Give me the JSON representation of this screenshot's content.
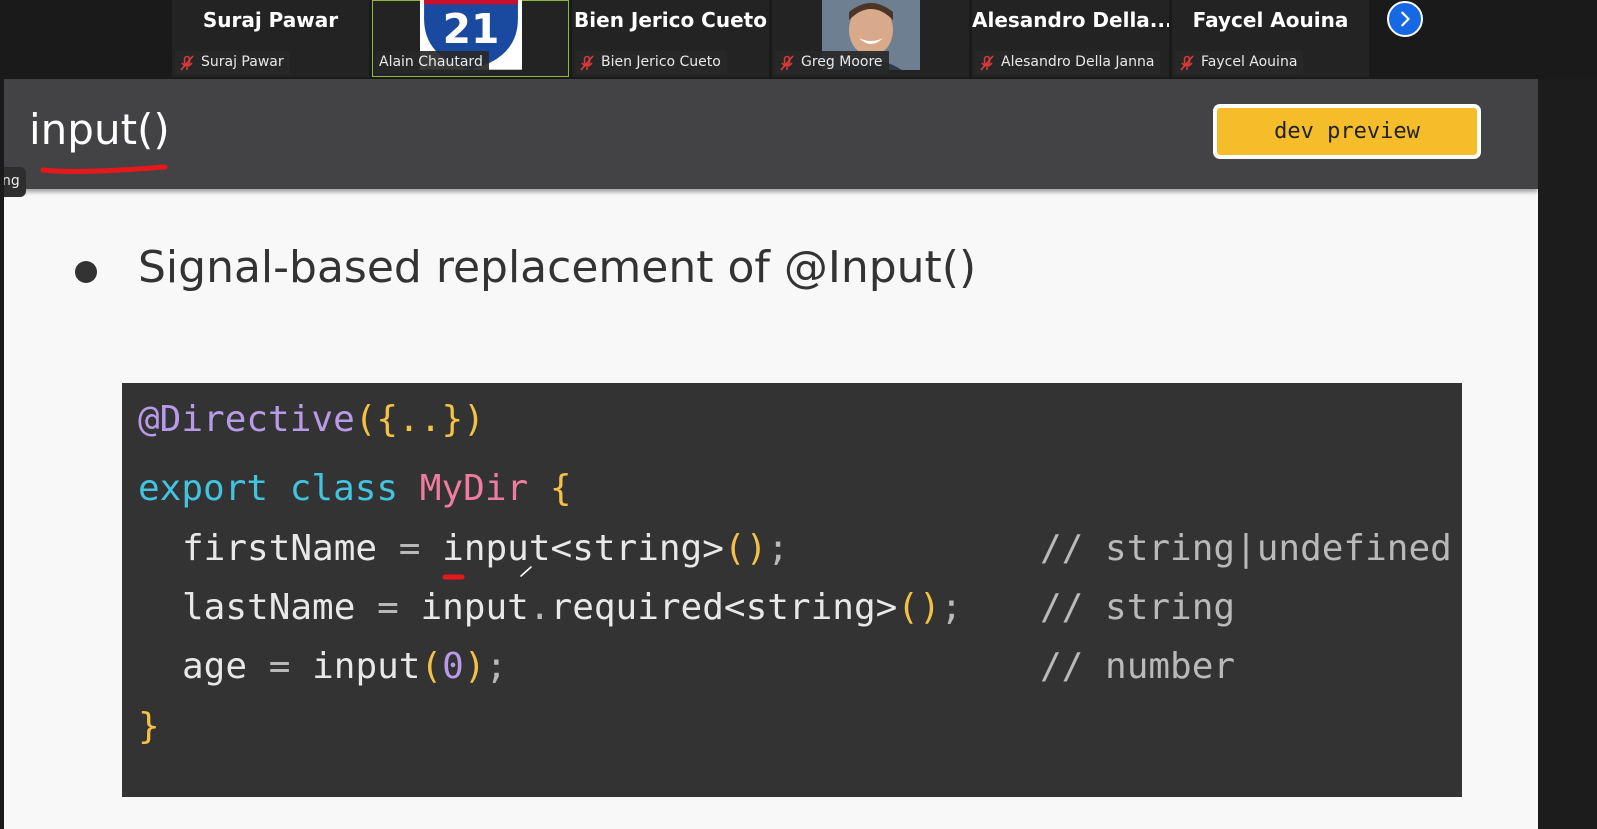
{
  "participants": [
    {
      "name_big": "Suraj Pawar",
      "label": "Suraj Pawar",
      "muted": true,
      "type": "name"
    },
    {
      "name_big": "",
      "label": "Alain Chautard",
      "muted": false,
      "type": "shield",
      "shield_text": "21"
    },
    {
      "name_big": "Bien Jerico Cueto",
      "label": "Bien Jerico Cueto",
      "muted": true,
      "type": "name"
    },
    {
      "name_big": "",
      "label": "Greg Moore",
      "muted": true,
      "type": "photo"
    },
    {
      "name_big": "Alesandro  Della...",
      "label": "Alesandro Della Janna",
      "muted": true,
      "type": "name"
    },
    {
      "name_big": "Faycel Aouina",
      "label": "Faycel Aouina",
      "muted": true,
      "type": "name"
    }
  ],
  "side_tab_text": "ng",
  "slide": {
    "title": "input()",
    "badge": "dev preview",
    "bullet": "Signal-based replacement of @Input()"
  },
  "code": {
    "line1": {
      "dec": "@Directive",
      "open": "({..})"
    },
    "line2": {
      "kw1": "export",
      "kw2": "class",
      "cls": "MyDir",
      "brace": "{"
    },
    "line3": {
      "id": "firstName",
      "eq": "=",
      "fn": "input",
      "gen": "<string>",
      "call": "()",
      "semi": ";",
      "comment": "// string|undefined"
    },
    "line4": {
      "id": "lastName",
      "eq": "=",
      "fn": "input",
      "dot": ".",
      "fn2": "required",
      "gen": "<string>",
      "call": "()",
      "semi": ";",
      "comment": "// string"
    },
    "line5": {
      "id": "age",
      "eq": "=",
      "fn": "input",
      "open": "(",
      "num": "0",
      "close": ")",
      "semi": ";",
      "comment": "// number"
    },
    "line6": {
      "brace": "}"
    }
  },
  "icons": {
    "next": "chevron-right-icon",
    "mic": "mic-off-icon"
  },
  "colors": {
    "header_bg": "#434345",
    "badge_bg": "#f6bd2b",
    "code_bg": "#333333",
    "keyword": "#42c3e0",
    "decorator": "#b89be8",
    "class_name": "#f07ba0",
    "bracket": "#f4c045",
    "annotation": "#e8171b",
    "next_button": "#1668e3"
  }
}
